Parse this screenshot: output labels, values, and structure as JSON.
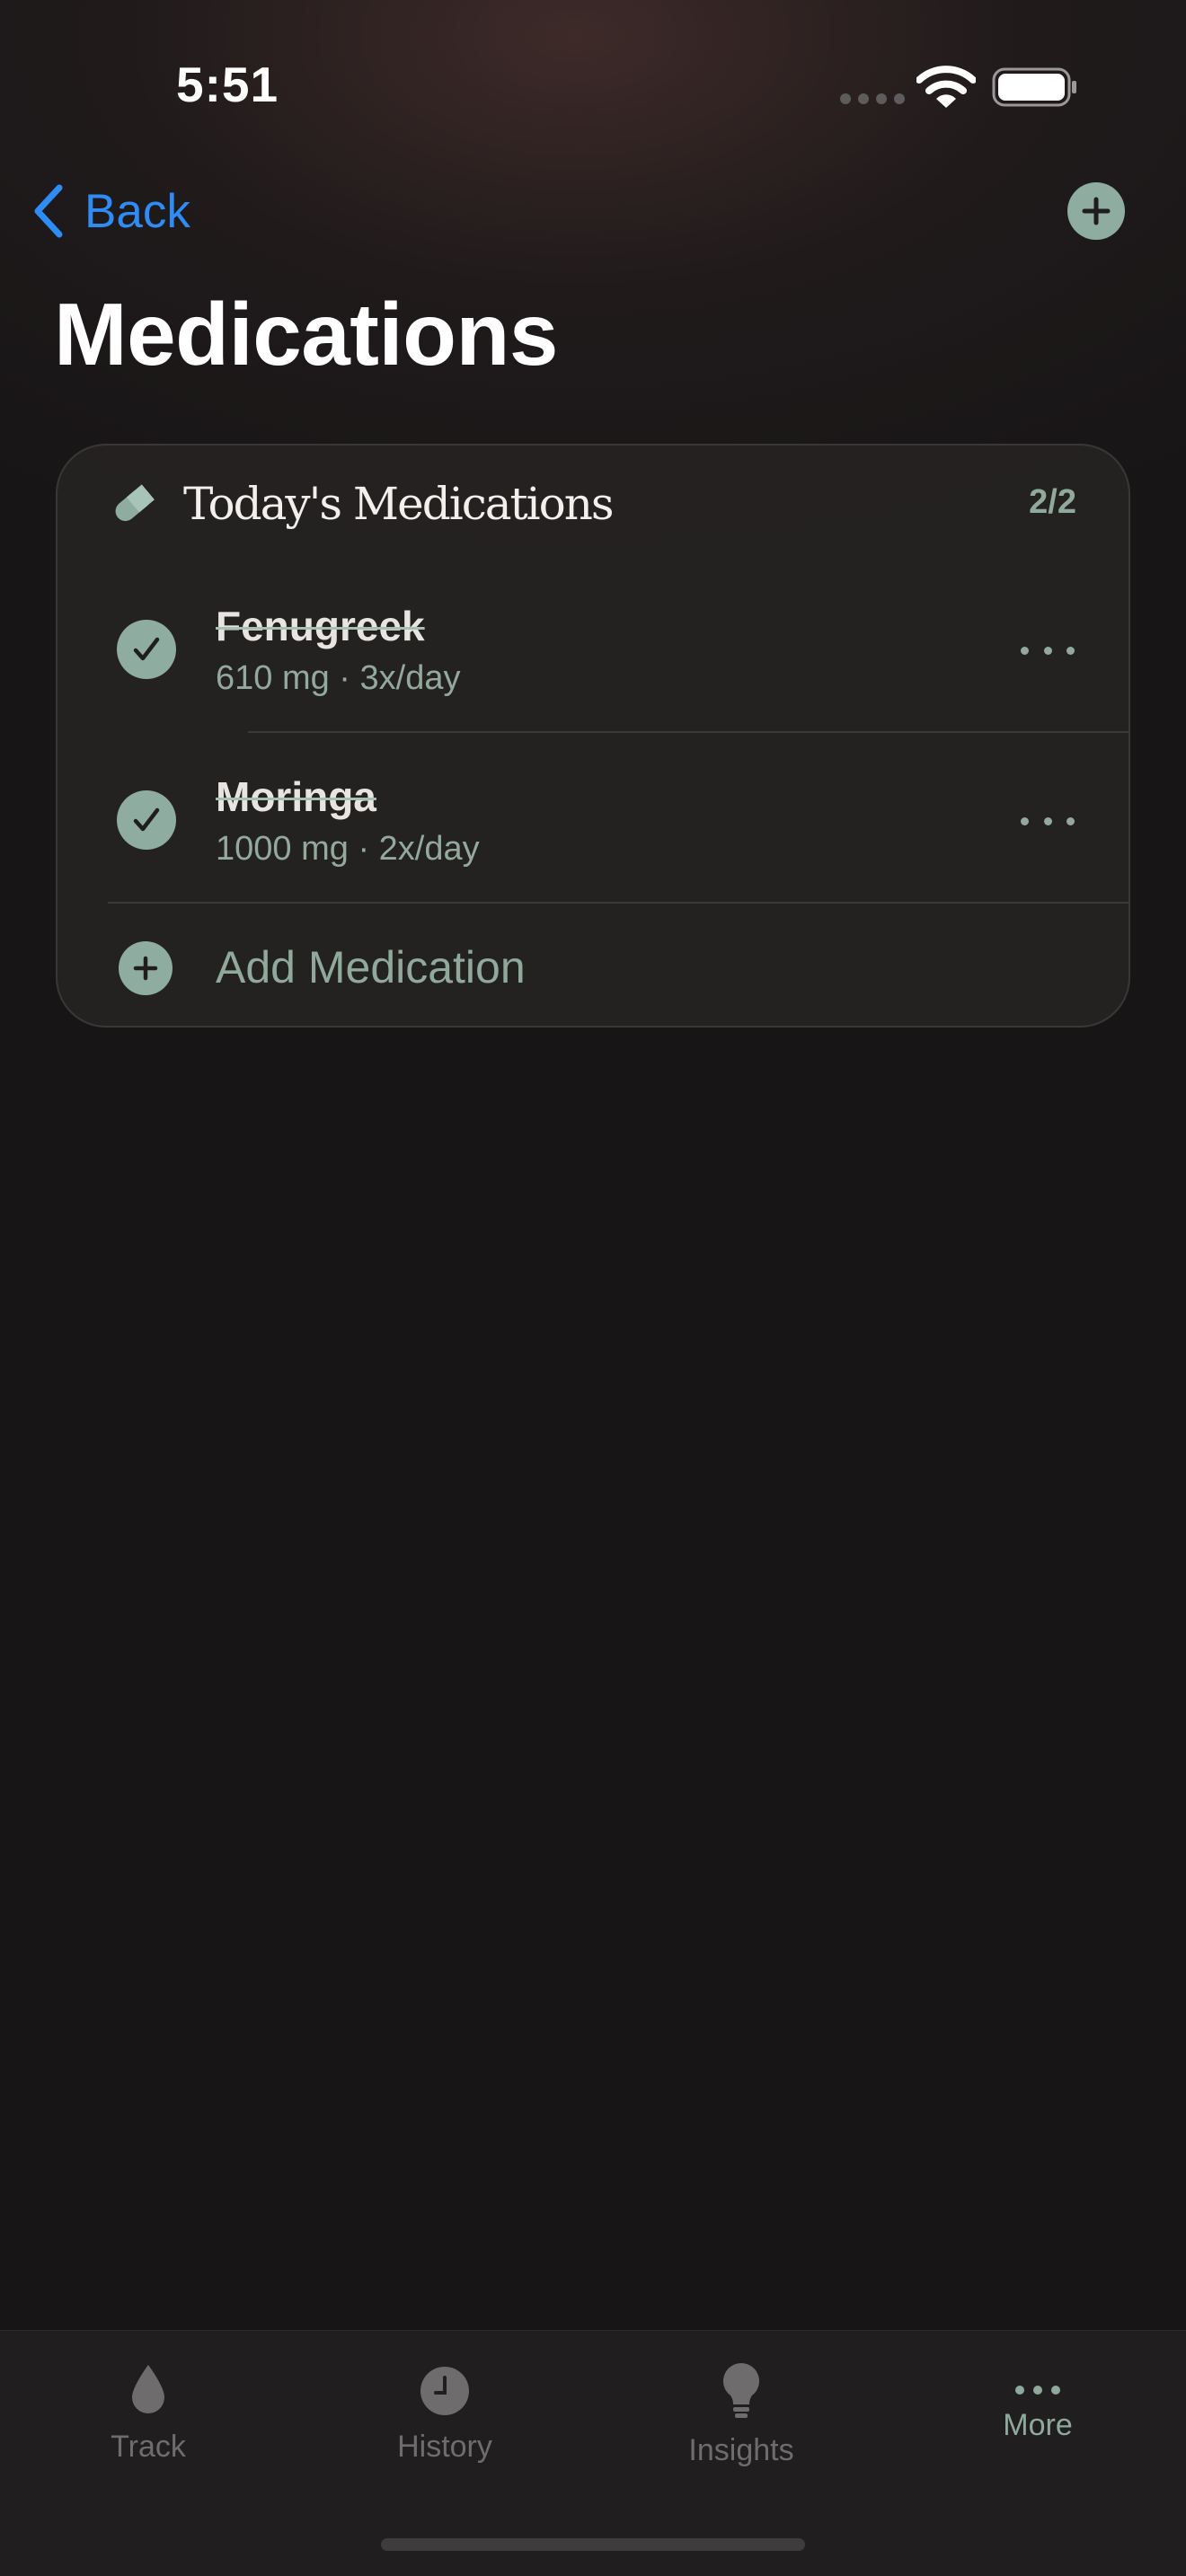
{
  "status_bar": {
    "time": "5:51"
  },
  "nav": {
    "back_label": "Back",
    "title": "Medications"
  },
  "card": {
    "title": "Today's Medications",
    "count": "2/2",
    "items": [
      {
        "name": "Fenugreek",
        "detail": "610 mg · 3x/day",
        "taken": true
      },
      {
        "name": "Moringa",
        "detail": "1000 mg · 2x/day",
        "taken": true
      }
    ],
    "add_label": "Add Medication"
  },
  "tab_bar": {
    "tabs": [
      {
        "label": "Track",
        "icon": "drop-icon"
      },
      {
        "label": "History",
        "icon": "clock-icon"
      },
      {
        "label": "Insights",
        "icon": "lightbulb-icon"
      },
      {
        "label": "More",
        "icon": "ellipsis-icon",
        "active": true
      }
    ]
  },
  "colors": {
    "accent": "#8eaca0",
    "link": "#2f8cf5",
    "background": "#171516",
    "card": "#262323"
  }
}
